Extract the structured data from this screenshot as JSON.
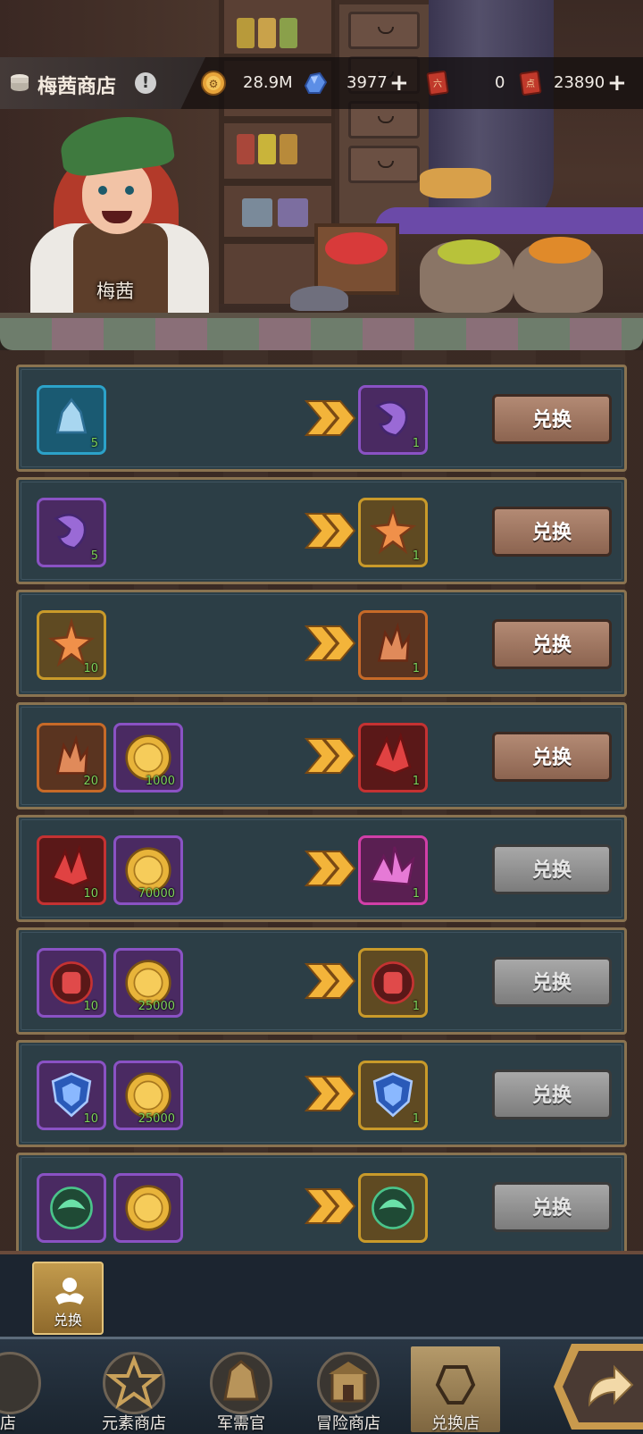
{
  "header": {
    "shop_title": "梅茜商店",
    "info_badge": "!",
    "keeper_name": "梅茜"
  },
  "currencies": [
    {
      "icon": "gold-coin-icon",
      "value": "28.9M",
      "has_plus": false
    },
    {
      "icon": "blue-crystal-icon",
      "value": "3977",
      "has_plus": true
    },
    {
      "icon": "red-ticket-icon",
      "value": "0",
      "has_plus": false
    },
    {
      "icon": "red-ticket-icon",
      "value": "23890",
      "has_plus": true
    }
  ],
  "exchange_button_label": "兑换",
  "rows": [
    {
      "inputs": [
        {
          "icon": "blue-crystal-shard-icon",
          "rarity": "blue",
          "qty": "5"
        }
      ],
      "output": {
        "icon": "purple-claw-stone-icon",
        "rarity": "purple",
        "qty": "1"
      },
      "enabled": true
    },
    {
      "inputs": [
        {
          "icon": "purple-claw-stone-icon",
          "rarity": "purple",
          "qty": "5"
        }
      ],
      "output": {
        "icon": "orange-star-crystal-icon",
        "rarity": "gold",
        "qty": "1"
      },
      "enabled": true
    },
    {
      "inputs": [
        {
          "icon": "orange-star-crystal-icon",
          "rarity": "gold",
          "qty": "10"
        }
      ],
      "output": {
        "icon": "orange-coral-crystal-icon",
        "rarity": "orange",
        "qty": "1"
      },
      "enabled": true
    },
    {
      "inputs": [
        {
          "icon": "orange-coral-crystal-icon",
          "rarity": "orange",
          "qty": "20"
        },
        {
          "icon": "gold-medal-coin-icon",
          "rarity": "purple",
          "qty": "1000"
        }
      ],
      "output": {
        "icon": "red-crystal-icon",
        "rarity": "red",
        "qty": "1"
      },
      "enabled": true
    },
    {
      "inputs": [
        {
          "icon": "red-crystal-icon",
          "rarity": "red",
          "qty": "10"
        },
        {
          "icon": "gold-medal-coin-icon",
          "rarity": "purple",
          "qty": "70000"
        }
      ],
      "output": {
        "icon": "pink-crystal-cluster-icon",
        "rarity": "pink",
        "qty": "1"
      },
      "enabled": false
    },
    {
      "inputs": [
        {
          "icon": "red-fist-emblem-icon",
          "rarity": "purple",
          "qty": "10"
        },
        {
          "icon": "gold-medal-coin-icon",
          "rarity": "purple",
          "qty": "25000"
        }
      ],
      "output": {
        "icon": "red-fist-emblem-icon",
        "rarity": "gold",
        "qty": "1"
      },
      "enabled": false
    },
    {
      "inputs": [
        {
          "icon": "blue-shield-emblem-icon",
          "rarity": "purple",
          "qty": "10"
        },
        {
          "icon": "gold-medal-coin-icon",
          "rarity": "purple",
          "qty": "25000"
        }
      ],
      "output": {
        "icon": "blue-shield-emblem-icon",
        "rarity": "gold",
        "qty": "1"
      },
      "enabled": false
    },
    {
      "inputs": [
        {
          "icon": "green-leaf-emblem-icon",
          "rarity": "purple",
          "qty": ""
        },
        {
          "icon": "gold-medal-coin-icon",
          "rarity": "purple",
          "qty": ""
        }
      ],
      "output": {
        "icon": "green-leaf-emblem-icon",
        "rarity": "gold",
        "qty": ""
      },
      "enabled": false
    }
  ],
  "sub_tab": {
    "label": "兑换",
    "icon": "exchange-hands-icon"
  },
  "nav": [
    {
      "label": "商店",
      "icon": "shop-icon"
    },
    {
      "label": "元素商店",
      "icon": "element-star-icon"
    },
    {
      "label": "军需官",
      "icon": "quartermaster-icon"
    },
    {
      "label": "冒险商店",
      "icon": "adventure-shop-icon"
    },
    {
      "label": "兑换店",
      "icon": "exchange-shop-icon"
    }
  ],
  "next_button": {
    "icon": "return-arrow-icon"
  }
}
